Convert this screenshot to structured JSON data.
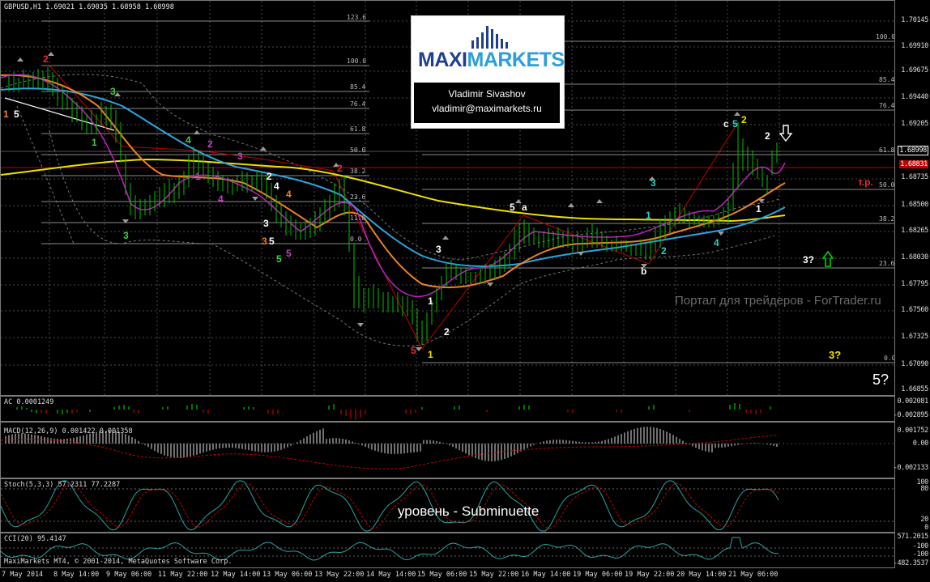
{
  "window": {
    "symbol_header": "GBPUSD,H1  1.69021 1.69035 1.68958 1.68998"
  },
  "logo": {
    "brand_left": "MAXI",
    "brand_right": "MARKETS",
    "author": "Vladimir Sivashov",
    "email": "vladimir@maximarkets.ru"
  },
  "price_axis": [
    "1.70145",
    "1.69910",
    "1.69675",
    "1.69440",
    "1.69205",
    "1.68998",
    "1.68831",
    "1.68735",
    "1.68500",
    "1.68265",
    "1.68030",
    "1.67795",
    "1.67560",
    "1.67325",
    "1.67090",
    "1.66855"
  ],
  "fib_left": [
    "123.6",
    "100.0",
    "85.4",
    "76.4",
    "61.8",
    "50.0",
    "38.2",
    "23.6",
    "11.8",
    "0.0"
  ],
  "fib_right": [
    "100.0",
    "85.4",
    "76.4",
    "61.8",
    "50.0",
    "38.2",
    "23.6",
    "0.0"
  ],
  "waves": {
    "w1": "1",
    "w5a": "5",
    "w2a": "2",
    "w3a": "3",
    "w4a": "4",
    "w3b": "3",
    "w1b": "1",
    "w4b": "4",
    "w2b": "2",
    "w1c": "1",
    "w2c": "2",
    "w3c": "3",
    "w4c": "4",
    "w5c": "5",
    "w3d": "3",
    "w5d": "5",
    "w4d": "4",
    "w5e": "5",
    "w3e": "3",
    "w2d": "2",
    "w5f": "5",
    "w1e": "1",
    "w2e": "2",
    "w3f": "3",
    "w1f": "1",
    "w3g": "3",
    "wa": "a",
    "w5g": "5",
    "wb": "b",
    "w1g": "1",
    "w2f": "2",
    "w3h": "3",
    "w4e": "4",
    "wc": "c",
    "w5h": "5",
    "w2g": "2",
    "w1h": "1",
    "w2h": "2"
  },
  "annotations": {
    "tp": "т.р.",
    "q3a": "3?",
    "q3b": "3?",
    "q5": "5?",
    "watermark": "Портал для трейдеров - ForTrader.ru",
    "sub_label": "уровень - Subminuette"
  },
  "indicators": {
    "ac": "AC 0.0001249",
    "ac_axis": [
      "0.002081",
      "-0.002895"
    ],
    "macd": "MACD(12,26,9) 0.001422 0.001358",
    "macd_axis": [
      "0.001752",
      "0.00",
      "-0.002133"
    ],
    "stoch": "Stoch(5,3,3) 57.2311 77.2287",
    "stoch_axis": [
      "100",
      "80",
      "20",
      "0"
    ],
    "cci": "CCI(20) 95.4147",
    "cci_axis": [
      "571.2015",
      "-100",
      "-100",
      "-482.3537"
    ],
    "footer": "MaxiMarkets MT4, © 2001-2014, MetaQuotes Software Corp."
  },
  "time_axis": [
    "7 May 2014",
    "8 May 14:00",
    "9 May 06:00",
    "11 May 22:00",
    "12 May 14:00",
    "13 May 06:00",
    "13 May 22:00",
    "14 May 14:00",
    "15 May 06:00",
    "15 May 22:00",
    "16 May 14:00",
    "19 May 06:00",
    "19 May 22:00",
    "20 May 14:00",
    "21 May 06:00"
  ],
  "colors": {
    "bg": "#000000",
    "bull": "#00c000",
    "grid": "#5a5a5a",
    "ema_yellow": "#f0e000",
    "ema_blue": "#2aa4e0",
    "ema_orange": "#f08020",
    "red_line": "#c00000",
    "magenta": "#c020c0"
  }
}
